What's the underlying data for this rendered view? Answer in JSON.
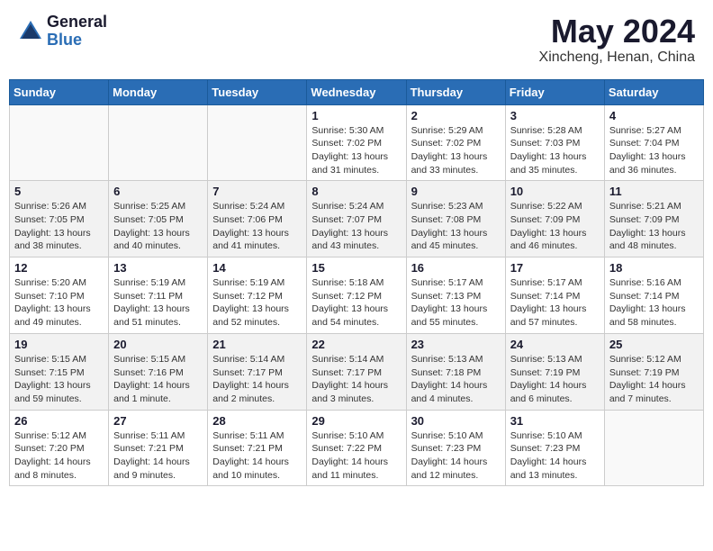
{
  "header": {
    "logo_general": "General",
    "logo_blue": "Blue",
    "title": "May 2024",
    "location": "Xincheng, Henan, China"
  },
  "calendar": {
    "days_of_week": [
      "Sunday",
      "Monday",
      "Tuesday",
      "Wednesday",
      "Thursday",
      "Friday",
      "Saturday"
    ],
    "weeks": [
      [
        {
          "day": "",
          "info": ""
        },
        {
          "day": "",
          "info": ""
        },
        {
          "day": "",
          "info": ""
        },
        {
          "day": "1",
          "info": "Sunrise: 5:30 AM\nSunset: 7:02 PM\nDaylight: 13 hours\nand 31 minutes."
        },
        {
          "day": "2",
          "info": "Sunrise: 5:29 AM\nSunset: 7:02 PM\nDaylight: 13 hours\nand 33 minutes."
        },
        {
          "day": "3",
          "info": "Sunrise: 5:28 AM\nSunset: 7:03 PM\nDaylight: 13 hours\nand 35 minutes."
        },
        {
          "day": "4",
          "info": "Sunrise: 5:27 AM\nSunset: 7:04 PM\nDaylight: 13 hours\nand 36 minutes."
        }
      ],
      [
        {
          "day": "5",
          "info": "Sunrise: 5:26 AM\nSunset: 7:05 PM\nDaylight: 13 hours\nand 38 minutes."
        },
        {
          "day": "6",
          "info": "Sunrise: 5:25 AM\nSunset: 7:05 PM\nDaylight: 13 hours\nand 40 minutes."
        },
        {
          "day": "7",
          "info": "Sunrise: 5:24 AM\nSunset: 7:06 PM\nDaylight: 13 hours\nand 41 minutes."
        },
        {
          "day": "8",
          "info": "Sunrise: 5:24 AM\nSunset: 7:07 PM\nDaylight: 13 hours\nand 43 minutes."
        },
        {
          "day": "9",
          "info": "Sunrise: 5:23 AM\nSunset: 7:08 PM\nDaylight: 13 hours\nand 45 minutes."
        },
        {
          "day": "10",
          "info": "Sunrise: 5:22 AM\nSunset: 7:09 PM\nDaylight: 13 hours\nand 46 minutes."
        },
        {
          "day": "11",
          "info": "Sunrise: 5:21 AM\nSunset: 7:09 PM\nDaylight: 13 hours\nand 48 minutes."
        }
      ],
      [
        {
          "day": "12",
          "info": "Sunrise: 5:20 AM\nSunset: 7:10 PM\nDaylight: 13 hours\nand 49 minutes."
        },
        {
          "day": "13",
          "info": "Sunrise: 5:19 AM\nSunset: 7:11 PM\nDaylight: 13 hours\nand 51 minutes."
        },
        {
          "day": "14",
          "info": "Sunrise: 5:19 AM\nSunset: 7:12 PM\nDaylight: 13 hours\nand 52 minutes."
        },
        {
          "day": "15",
          "info": "Sunrise: 5:18 AM\nSunset: 7:12 PM\nDaylight: 13 hours\nand 54 minutes."
        },
        {
          "day": "16",
          "info": "Sunrise: 5:17 AM\nSunset: 7:13 PM\nDaylight: 13 hours\nand 55 minutes."
        },
        {
          "day": "17",
          "info": "Sunrise: 5:17 AM\nSunset: 7:14 PM\nDaylight: 13 hours\nand 57 minutes."
        },
        {
          "day": "18",
          "info": "Sunrise: 5:16 AM\nSunset: 7:14 PM\nDaylight: 13 hours\nand 58 minutes."
        }
      ],
      [
        {
          "day": "19",
          "info": "Sunrise: 5:15 AM\nSunset: 7:15 PM\nDaylight: 13 hours\nand 59 minutes."
        },
        {
          "day": "20",
          "info": "Sunrise: 5:15 AM\nSunset: 7:16 PM\nDaylight: 14 hours\nand 1 minute."
        },
        {
          "day": "21",
          "info": "Sunrise: 5:14 AM\nSunset: 7:17 PM\nDaylight: 14 hours\nand 2 minutes."
        },
        {
          "day": "22",
          "info": "Sunrise: 5:14 AM\nSunset: 7:17 PM\nDaylight: 14 hours\nand 3 minutes."
        },
        {
          "day": "23",
          "info": "Sunrise: 5:13 AM\nSunset: 7:18 PM\nDaylight: 14 hours\nand 4 minutes."
        },
        {
          "day": "24",
          "info": "Sunrise: 5:13 AM\nSunset: 7:19 PM\nDaylight: 14 hours\nand 6 minutes."
        },
        {
          "day": "25",
          "info": "Sunrise: 5:12 AM\nSunset: 7:19 PM\nDaylight: 14 hours\nand 7 minutes."
        }
      ],
      [
        {
          "day": "26",
          "info": "Sunrise: 5:12 AM\nSunset: 7:20 PM\nDaylight: 14 hours\nand 8 minutes."
        },
        {
          "day": "27",
          "info": "Sunrise: 5:11 AM\nSunset: 7:21 PM\nDaylight: 14 hours\nand 9 minutes."
        },
        {
          "day": "28",
          "info": "Sunrise: 5:11 AM\nSunset: 7:21 PM\nDaylight: 14 hours\nand 10 minutes."
        },
        {
          "day": "29",
          "info": "Sunrise: 5:10 AM\nSunset: 7:22 PM\nDaylight: 14 hours\nand 11 minutes."
        },
        {
          "day": "30",
          "info": "Sunrise: 5:10 AM\nSunset: 7:23 PM\nDaylight: 14 hours\nand 12 minutes."
        },
        {
          "day": "31",
          "info": "Sunrise: 5:10 AM\nSunset: 7:23 PM\nDaylight: 14 hours\nand 13 minutes."
        },
        {
          "day": "",
          "info": ""
        }
      ]
    ]
  }
}
